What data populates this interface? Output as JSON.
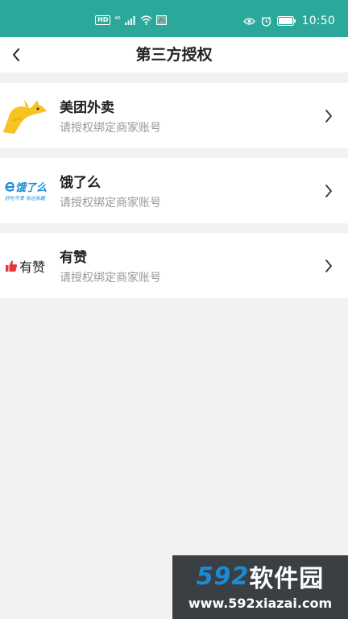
{
  "status_bar": {
    "hd": "HD",
    "network": "⁴⁶",
    "time": "10:50"
  },
  "nav": {
    "title": "第三方授权"
  },
  "items": [
    {
      "name": "美团外卖",
      "desc": "请授权绑定商家账号",
      "logo_icon": "meituan-kangaroo-logo"
    },
    {
      "name": "饿了么",
      "desc": "请授权绑定商家账号",
      "logo_icon": "eleme-logo",
      "logo_text": "饿了么",
      "logo_sub": "好吃不贵 有运有趣"
    },
    {
      "name": "有赞",
      "desc": "请授权绑定商家账号",
      "logo_icon": "youzan-logo",
      "logo_text": "有赞"
    }
  ],
  "watermark": {
    "num": "592",
    "cn": "软件园",
    "url": "www.592xiazai.com"
  },
  "colors": {
    "status_bar": "#2ca89a",
    "background": "#f2f2f2",
    "meituan_yellow": "#f7c320",
    "eleme_blue": "#1a8bd6",
    "youzan_red": "#e4393c"
  }
}
